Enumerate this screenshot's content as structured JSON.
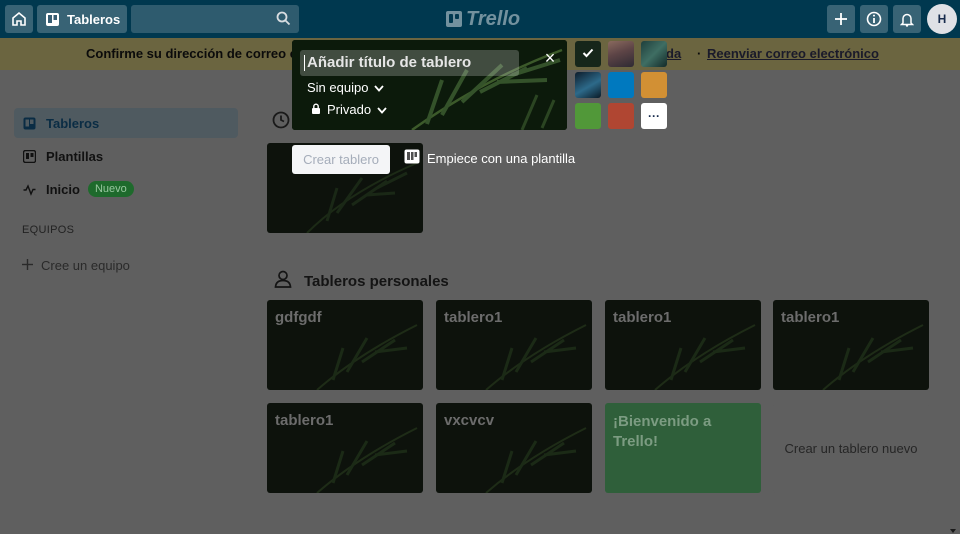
{
  "header": {
    "boards_label": "Tableros",
    "logo_text": "Trello",
    "avatar_initial": "H"
  },
  "banner": {
    "message": "Confirme su dirección de correo e",
    "link_partial": "da",
    "separator": "·",
    "resend_link": "Reenviar correo electrónico"
  },
  "sidebar": {
    "items": [
      {
        "label": "Tableros"
      },
      {
        "label": "Plantillas"
      },
      {
        "label": "Inicio",
        "badge": "Nuevo"
      }
    ],
    "teams_heading": "EQUIPOS",
    "create_team": "Cree un equipo"
  },
  "dialog": {
    "title_placeholder": "Añadir título de tablero",
    "team_select": "Sin equipo",
    "visibility_select": "Privado",
    "close_symbol": "×",
    "create_button": "Crear tablero",
    "template_link": "Empiece con una plantilla",
    "more_symbol": "···",
    "swatch_colors": [
      "#0079bf",
      "#d29034",
      "#519839",
      "#b04632",
      "#ffffff"
    ]
  },
  "personal": {
    "heading": "Tableros personales",
    "boards": [
      {
        "name": "gdfgdf"
      },
      {
        "name": "tablero1"
      },
      {
        "name": "tablero1"
      },
      {
        "name": "tablero1"
      },
      {
        "name": "tablero1"
      },
      {
        "name": "vxcvcv"
      },
      {
        "name": "¡Bienvenido a Trello!"
      }
    ],
    "create_new": "Crear un tablero nuevo"
  }
}
